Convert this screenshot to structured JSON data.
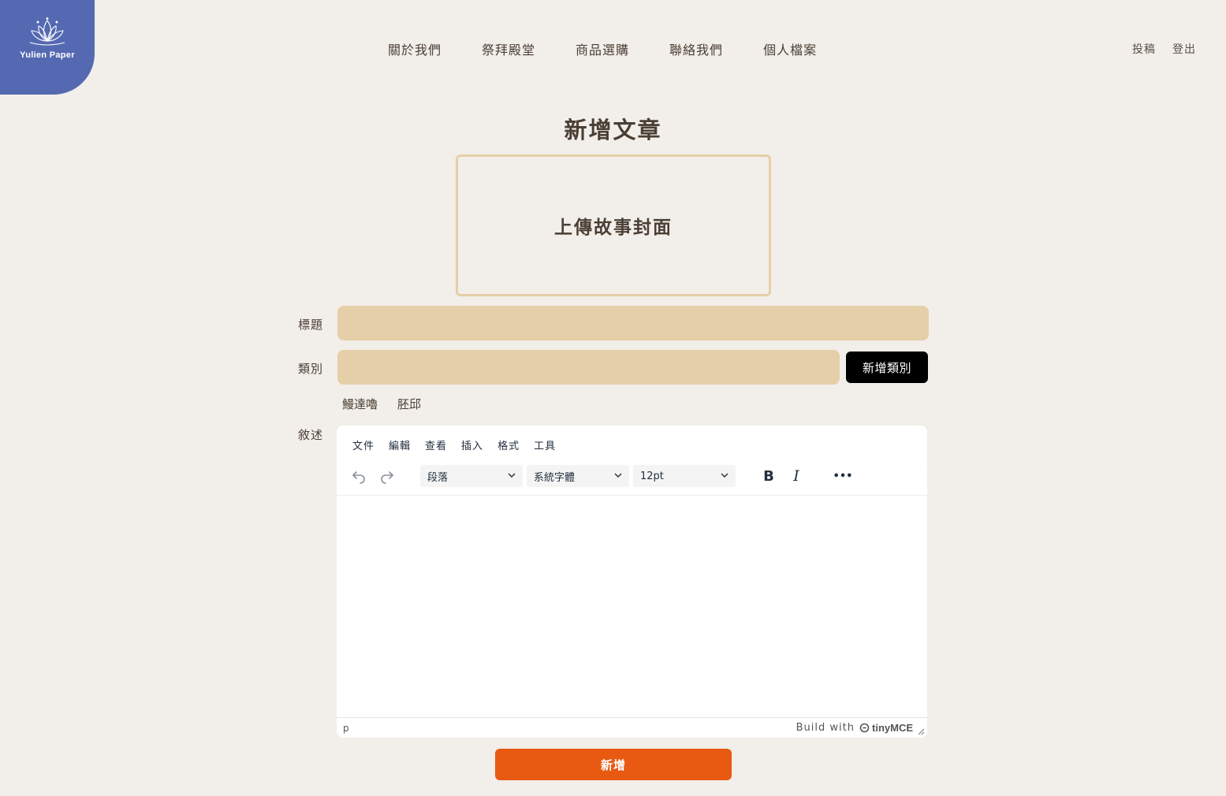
{
  "logo": {
    "text": "Yulien Paper",
    "icon": "lotus-icon"
  },
  "nav": {
    "items": [
      "關於我們",
      "祭拜殿堂",
      "商品選購",
      "聯絡我們",
      "個人檔案"
    ]
  },
  "top_right": {
    "submit": "投稿",
    "logout": "登出"
  },
  "page_title": "新增文章",
  "cover_upload": {
    "label": "上傳故事封面"
  },
  "form": {
    "title_label": "標題",
    "title_value": "",
    "category_label": "類別",
    "category_value": "",
    "add_category_button": "新增類別",
    "category_tags": [
      "鰻達嚕",
      "胚邱"
    ],
    "description_label": "敘述"
  },
  "editor": {
    "menu": [
      "文件",
      "編輯",
      "查看",
      "插入",
      "格式",
      "工具"
    ],
    "block_format": "段落",
    "font_family": "系統字體",
    "font_size": "12pt",
    "bold_label": "B",
    "italic_label": "I",
    "more_label": "•••",
    "status_path": "p",
    "build_with": "Build with",
    "brand": "tinyMCE"
  },
  "submit_button": "新增",
  "colors": {
    "background": "#f2eee9",
    "logo_bg": "#5469b1",
    "input_bg": "#e5cfa8",
    "primary_text": "#4a3f35",
    "submit": "#e85a12"
  }
}
